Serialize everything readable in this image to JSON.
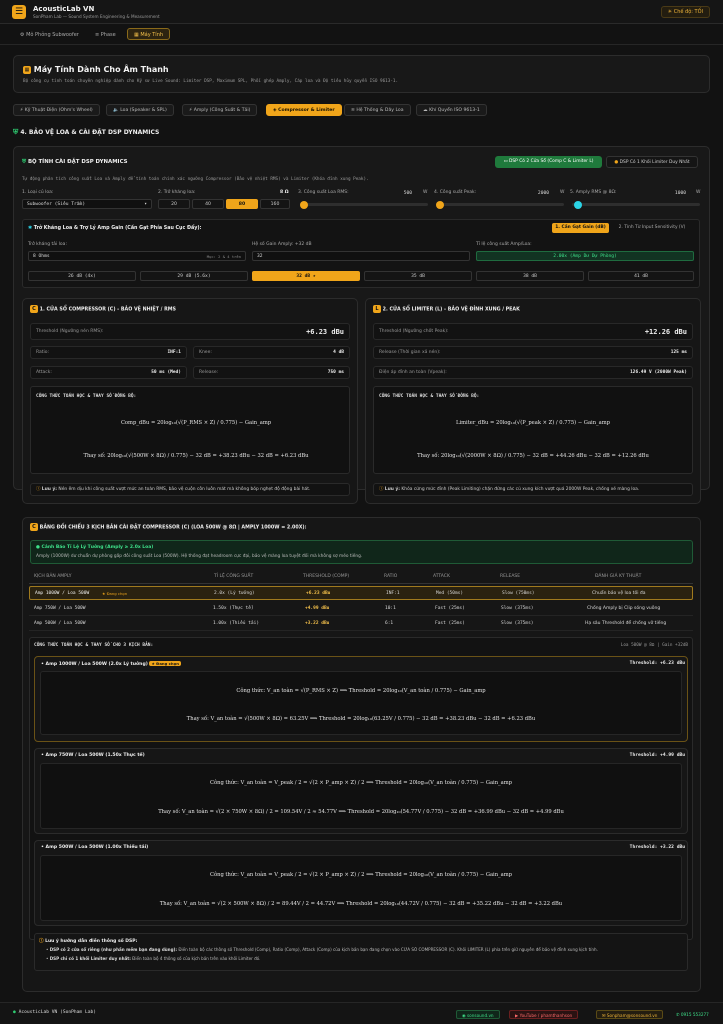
{
  "app": {
    "title": "AcousticLab VN",
    "subtitle": "SonPham Lab — Sound System Engineering & Measurement",
    "theme_btn": "Chế độ: TỐI"
  },
  "nav": [
    {
      "label": "Mô Phỏng Subwoofer"
    },
    {
      "label": "Phase"
    },
    {
      "label": "Máy Tính"
    }
  ],
  "page": {
    "title": "Máy Tính Dành Cho Âm Thanh",
    "desc": "Bộ công cụ tính toán chuyên nghiệp dành cho Kỹ sư Live Sound: Limiter DSP, Maximum SPL, Phối ghép Amply, Cáp loa và Độ tiêu hủy quyển ISO 9613-1."
  },
  "subtabs": [
    {
      "label": "Kỹ Thuật Điện (Ohm's Wheel)"
    },
    {
      "label": "Loa (Speaker & SPL)"
    },
    {
      "label": "Amply (Công Suất & Tải)"
    },
    {
      "label": "Compressor & Limiter"
    },
    {
      "label": "Hệ Thống & Dây Loa"
    },
    {
      "label": "Khí Quyển ISO 9613-1"
    }
  ],
  "section_title": "4. BẢO VỆ LOA & CÀI ĐẶT DSP DYNAMICS",
  "calc": {
    "title": "BỘ TÍNH CÀI ĐẶT DSP DYNAMICS",
    "desc": "Tự động phân tích công suất Loa và Amply để tính toán chính xác ngưỡng Compressor (Bảo vệ nhiệt RMS) và Limiter (Khóa đỉnh xung Peak).",
    "mode_a": "DSP Có 2 Cửa Sổ (Comp C & Limiter L)",
    "mode_b": "DSP Có 1 Khối Limiter Duy Nhất",
    "f1_label": "1. Loại củ loa:",
    "f1_value": "Subwoofer (Siêu Trầm)",
    "f2_label": "2. Trở kháng loa:",
    "f2_value": "8 Ω",
    "f2_opts": [
      "20",
      "40",
      "80",
      "160"
    ],
    "f3_label": "3. Công suất Loa RMS:",
    "f3_value": "500",
    "f3_unit": "W",
    "f4_label": "4. Công suất Peak:",
    "f4_value": "2000",
    "f4_unit": "W",
    "f5_label": "5. Amply RMS @ 8Ω:",
    "f5_value": "1000",
    "f5_unit": "W"
  },
  "gain": {
    "title": "Trở Kháng Loa & Trợ Lý Amp Gain (Cần Gạt Phía Sau Cục Đẩy):",
    "tab_a": "1. Cần Gạt Gain (dB)",
    "tab_b": "2. Tính Từ Input Sensitivity (V)",
    "imp_label": "Trở kháng tải loa:",
    "imp_value": "8 Ohms",
    "imp_hint": "Mục: 2 & 4 trên",
    "gain_label": "Hệ số Gain Amply: +32 dB",
    "gain_value": "32",
    "ratio_label": "Tỉ lệ công suất Amp/Loa:",
    "ratio_value": "2.00x (Amp Dư Dự Phòng)",
    "opts": [
      "26 dB (4x)",
      "29 dB (5.6x)",
      "32 dB ★",
      "35 dB",
      "38 dB",
      "41 dB"
    ]
  },
  "comp": {
    "title": "1. CỬA SỔ COMPRESSOR (C) - BẢO VỆ NHIỆT / RMS",
    "threshold_label": "Threshold (Ngưỡng nén RMS):",
    "threshold_value": "+6.23 dBu",
    "ratio_label": "Ratio:",
    "ratio_value": "INF:1",
    "knee_label": "Knee:",
    "knee_value": "4 dB",
    "attack_label": "Attack:",
    "attack_value": "50 ms (Med)",
    "release_label": "Release:",
    "release_value": "750 ms",
    "formula_title": "CÔNG THỨC TOÁN HỌC & THAY SỐ ĐỒNG BỘ:",
    "eq1": "Comp_dBu = 20log₁₀(√(P_RMS × Z) / 0.775) − Gain_amp",
    "eq2": "Thay số: 20log₁₀(√(500W × 8Ω) / 0.775) − 32 dB = +38.23 dBu − 32 dB = +6.23 dBu",
    "note_head": "Lưu ý:",
    "note": "Nén êm dịu khi công suất vượt mức an toàn RMS, bảo vệ cuộn côn luôn mát mà không bóp nghẹt độ động bài hát."
  },
  "lim": {
    "title": "2. CỬA SỔ LIMITER (L) - BẢO VỆ ĐỈNH XUNG / PEAK",
    "threshold_label": "Threshold (Ngưỡng chốt Peak):",
    "threshold_value": "+12.26 dBu",
    "release_label": "Release (Thời gian xả nén):",
    "release_value": "125 ms",
    "volt_label": "Điện áp đỉnh an toàn (Vpeak):",
    "volt_value": "126.49 V (2000W Peak)",
    "formula_title": "CÔNG THỨC TOÁN HỌC & THAY SỐ ĐỒNG BỘ:",
    "eq1": "Limiter_dBu = 20log₁₀(√(P_peak × Z) / 0.775) − Gain_amp",
    "eq2": "Thay số: 20log₁₀(√(2000W × 8Ω) / 0.775) − 32 dB = +44.26 dBu − 32 dB = +12.26 dBu",
    "note_head": "Lưu ý:",
    "note": "Khóa cứng mức đỉnh (Peak Limiting) chặn đứng các cú xung kích vượt quá 2000W Peak, chống xé màng loa."
  },
  "compare": {
    "title": "BẢNG ĐỐI CHIẾU 3 KỊCH BẢN CÀI ĐẶT COMPRESSOR (C) (LOA 500W @ 8Ω | AMPLY 1000W = 2.00X):",
    "warn_title": "Cảnh Báo Tỉ Lệ Lý Tưởng (Amply ≥ 2.0x Loa)",
    "warn_text": "Amply (1000W) dư chuẩn dự phòng gấp đôi công suất Loa (500W). Hệ thống đạt headroom cực đại, bảo vệ màng loa tuyệt đối mà không sợ méo tiếng.",
    "headers": [
      "KỊCH BẢN AMPLY",
      "TỈ LỆ CÔNG SUẤT",
      "THRESHOLD (COMP)",
      "RATIO",
      "ATTACK",
      "RELEASE",
      "ĐÁNH GIÁ KỸ THUẬT"
    ],
    "rows": [
      [
        "Amp 1000W / Loa 500W",
        "2.0x (Lý tưởng)",
        "+6.23 dBu",
        "INF:1",
        "Med (50ms)",
        "Slow (750ms)",
        "Chuẩn bảo vệ loa tối đa"
      ],
      [
        "Amp 750W / Loa 500W",
        "1.50x (Thực tế)",
        "+4.99 dBu",
        "10:1",
        "Fast (25ms)",
        "Slow (375ms)",
        "Chống Amply bị Clip sóng vuông"
      ],
      [
        "Amp 500W / Loa 500W",
        "1.00x (Thiếu tải)",
        "+3.22 dBu",
        "6:1",
        "Fast (25ms)",
        "Slow (375ms)",
        "Hạ sâu Threshold để chống vỡ tiếng"
      ]
    ],
    "selected_badge": "★ Đang chọn",
    "formula_title": "CÔNG THỨC TOÁN HỌC & THAY SỐ CHO 3 KỊCH BẢN:",
    "formula_meta": "Loa 500W @ 8Ω | Gain +32dB"
  },
  "scenarios": [
    {
      "title": "Amp 1000W / Loa 500W (2.0x Lý tưởng)",
      "badge": "★ Đang chọn",
      "thr": "Threshold: +6.23 dBu",
      "eq1": "Công thức: V_an toàn = √(P_RMS × Z)  ⟹  Threshold = 20log₁₀(V_an toàn / 0.775) − Gain_amp",
      "eq2": "Thay số: V_an toàn = √(500W × 8Ω) = 63.25V  ⟹  Threshold = 20log₁₀(63.25V / 0.775) − 32 dB = +38.23 dBu − 32 dB = +6.23 dBu"
    },
    {
      "title": "Amp 750W / Loa 500W (1.50x Thực tế)",
      "badge": "",
      "thr": "Threshold: +4.99 dBu",
      "eq1": "Công thức: V_an toàn = V_peak / 2 = √(2 × P_amp × Z) / 2  ⟹  Threshold = 20log₁₀(V_an toàn / 0.775) − Gain_amp",
      "eq2": "Thay số: V_an toàn = √(2 × 750W × 8Ω) / 2 = 109.54V / 2 ≈ 54.77V  ⟹  Threshold = 20log₁₀(54.77V / 0.775) − 32 dB = +36.99 dBu − 32 dB = +4.99 dBu"
    },
    {
      "title": "Amp 500W / Loa 500W (1.00x Thiếu tải)",
      "badge": "",
      "thr": "Threshold: +3.22 dBu",
      "eq1": "Công thức: V_an toàn = V_peak / 2 = √(2 × P_amp × Z) / 2  ⟹  Threshold = 20log₁₀(V_an toàn / 0.775) − Gain_amp",
      "eq2": "Thay số: V_an toàn = √(2 × 500W × 8Ω) / 2 = 89.44V / 2 = 44.72V  ⟹  Threshold = 20log₁₀(44.72V / 0.775) − 32 dB = +35.22 dBu − 32 dB = +3.22 dBu"
    }
  ],
  "guide": {
    "title": "Lưu ý hướng dẫn điền thông số DSP:",
    "l1_head": "DSP có 2 cửa sổ riêng (như phần mềm bạn đang dùng):",
    "l1": "Điền toàn bộ các thông số Threshold (Comp), Ratio (Comp), Attack (Comp) của kịch bản bạn đang chọn vào CỬA SỔ COMPRESSOR (C). Khối LIMITER (L) phía trên giữ nguyên để bảo vệ đỉnh xung kịch tính.",
    "l2_head": "DSP chỉ có 1 khối Limiter duy nhất:",
    "l2": "Điền toàn bộ 4 thông số của kịch bản trên vào khối Limiter đó."
  },
  "footer": {
    "left": "AcousticLab VN (SonPham Lab)",
    "web": "sonsound.vn",
    "yt": "YouTube / phamthanhson",
    "mail": "Sonpham@sonsound.vn",
    "phone": "0915 553277"
  },
  "colors": {
    "accent": "#f0a51a",
    "green": "#2ecc71",
    "panel": "#181818"
  }
}
